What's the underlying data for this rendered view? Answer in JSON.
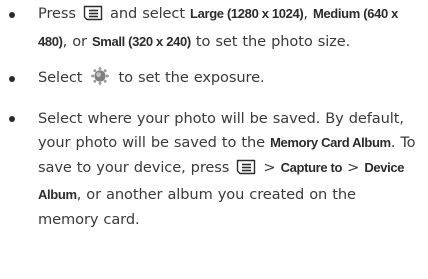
{
  "bullets": [
    {
      "t1": "Press",
      "icon1": "menu-key-icon",
      "t2": "and select",
      "large": "Large (1280 x 1024)",
      "t3": ",",
      "medium": "Medium (640 x 480)",
      "t4": ", or",
      "small": "Small (320 x 240)",
      "t5": "to set the photo size."
    },
    {
      "t1": "Select",
      "icon1": "exposure-icon",
      "t2": "to set the exposure."
    },
    {
      "t1": "Select where your photo will be saved. By default, your photo will be saved to the",
      "memory_card_album": "Memory Card Album",
      "t2": ". To save to your device, press",
      "icon1": "menu-key-icon",
      "t3": ">",
      "capture_to": "Capture to",
      "t4": ">",
      "device_album": "Device Album",
      "t5": ", or another album you created on the memory card."
    }
  ],
  "colors": {
    "text": "#3a3a3a",
    "bullet": "#2b2b2b",
    "exposure_icon": "#8e8e8e"
  }
}
